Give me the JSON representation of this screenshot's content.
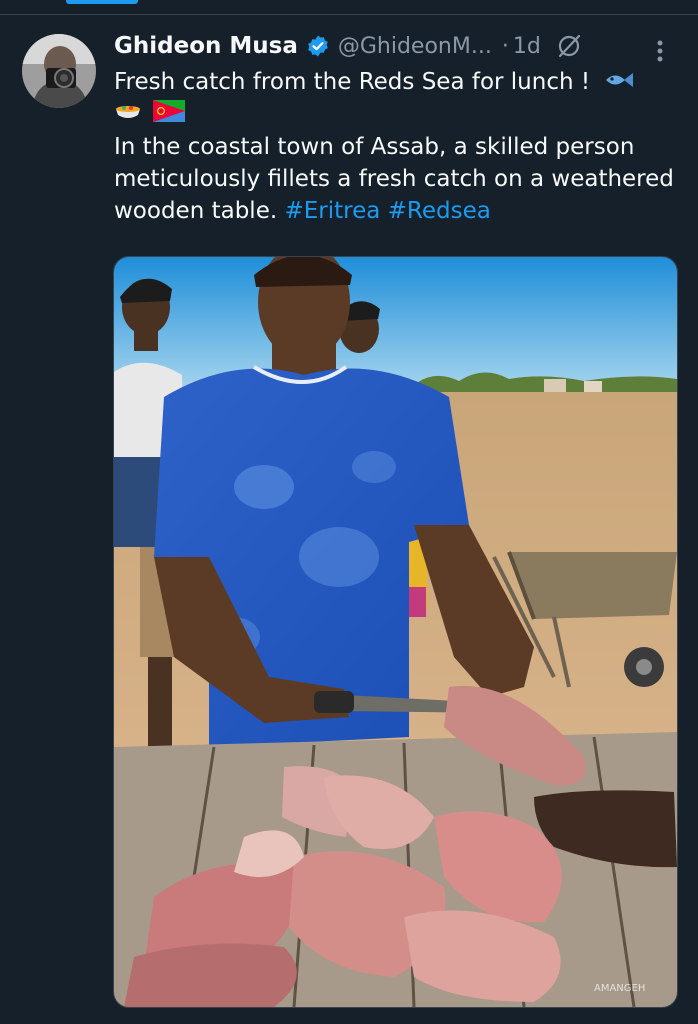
{
  "tweet": {
    "display_name": "Ghideon Musa",
    "handle": "@GhideonM...",
    "separator": "·",
    "timestamp": "1d",
    "line1": "Fresh catch from the Reds Sea for lunch !",
    "body_text": "In the coastal town of Assab, a skilled person meticulously fillets a fresh catch on a weathered wooden table.",
    "hashtags": [
      "#Eritrea",
      "#Redsea"
    ],
    "emojis": [
      "fish-emoji",
      "bowl-emoji",
      "eritrea-flag-emoji"
    ],
    "media_watermark": "AMANGEH"
  },
  "icons": {
    "verified": "verified-badge-icon",
    "grok": "grok-icon",
    "more": "more-vertical-icon"
  },
  "colors": {
    "background": "#15202b",
    "text": "#f7f9f9",
    "secondary": "#8b98a5",
    "accent": "#1d9bf0",
    "divider": "#38444d"
  }
}
